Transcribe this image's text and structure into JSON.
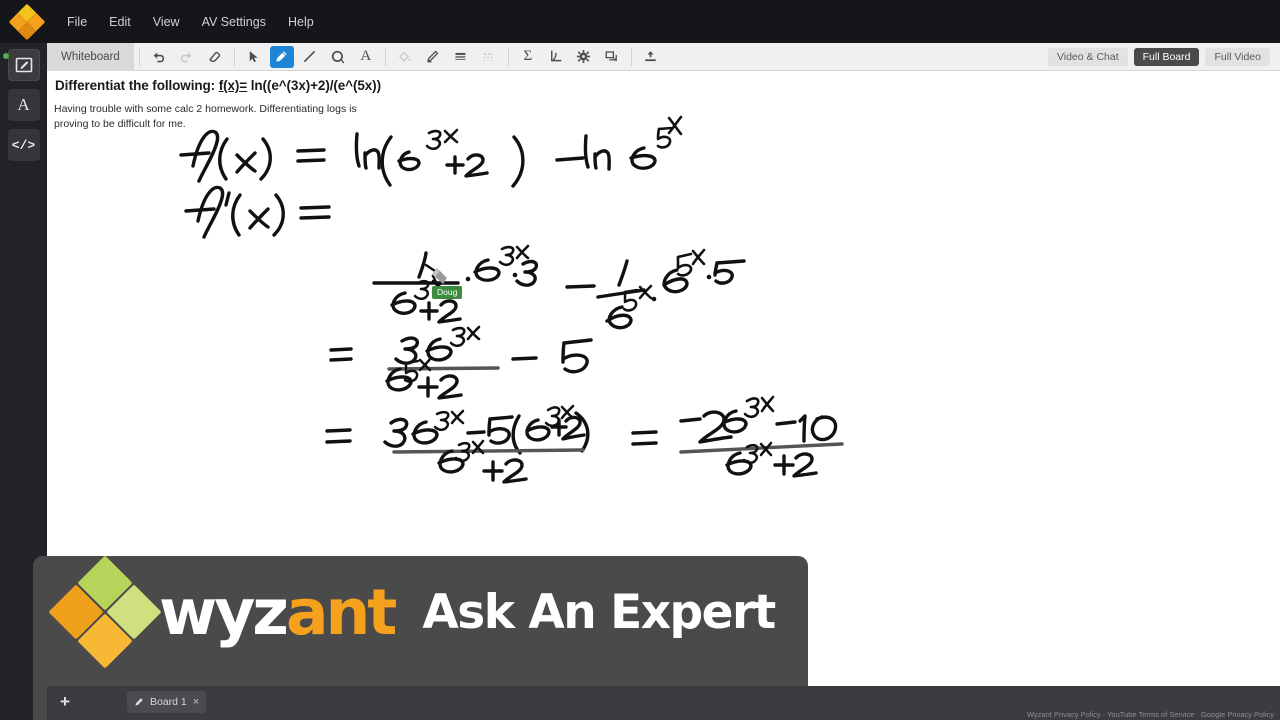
{
  "app": {
    "brand_name": "wyzant",
    "accent_orange": "#f5a11e",
    "accent_green": "#9fc93c",
    "accent_yellow": "#f2c41c",
    "active_tool_blue": "#1e85d6",
    "cursor_green": "#3d8b3d"
  },
  "menubar": {
    "logo_name": "wyzant-diamond-logo",
    "items": [
      {
        "label": "File",
        "name": "menu-file"
      },
      {
        "label": "Edit",
        "name": "menu-edit"
      },
      {
        "label": "View",
        "name": "menu-view"
      },
      {
        "label": "AV Settings",
        "name": "menu-av-settings"
      },
      {
        "label": "Help",
        "name": "menu-help"
      }
    ]
  },
  "left_rail": {
    "items": [
      {
        "name": "sidebar-item-whiteboard",
        "icon": "whiteboard-pen-icon",
        "active": true,
        "status_dot": true
      },
      {
        "name": "sidebar-item-text",
        "icon": "text-document-icon",
        "glyph": "A",
        "active": false
      },
      {
        "name": "sidebar-item-code",
        "icon": "code-icon",
        "glyph": "</>",
        "active": false
      }
    ]
  },
  "toolbar": {
    "whiteboard_tab_label": "Whiteboard",
    "tools": [
      {
        "name": "undo-button",
        "icon": "undo-arrow-icon",
        "state": "enabled"
      },
      {
        "name": "redo-button",
        "icon": "redo-arrow-icon",
        "state": "disabled"
      },
      {
        "name": "eraser-button",
        "icon": "eraser-icon",
        "state": "enabled"
      },
      {
        "name": "select-button",
        "icon": "cursor-arrow-icon",
        "state": "enabled"
      },
      {
        "name": "pen-button",
        "icon": "pen-icon",
        "state": "selected"
      },
      {
        "name": "line-button",
        "icon": "line-icon",
        "state": "enabled"
      },
      {
        "name": "shape-button",
        "icon": "ellipse-shape-icon",
        "state": "enabled"
      },
      {
        "name": "text-button",
        "icon": "text-a-icon",
        "state": "enabled"
      },
      {
        "name": "fill-button",
        "icon": "paint-bucket-icon",
        "state": "disabled"
      },
      {
        "name": "stroke-color-button",
        "icon": "marker-color-icon",
        "state": "enabled"
      },
      {
        "name": "stroke-width-button",
        "icon": "line-weight-icon",
        "state": "enabled"
      },
      {
        "name": "line-style-button",
        "icon": "dashed-line-icon",
        "state": "disabled"
      },
      {
        "name": "math-button",
        "icon": "sigma-math-icon",
        "state": "enabled"
      },
      {
        "name": "graph-button",
        "icon": "graph-axes-icon",
        "state": "enabled"
      },
      {
        "name": "settings-button",
        "icon": "gear-icon",
        "state": "enabled"
      },
      {
        "name": "duplicate-button",
        "icon": "copy-layers-icon",
        "state": "enabled"
      },
      {
        "name": "upload-button",
        "icon": "upload-icon",
        "state": "enabled"
      }
    ],
    "view_buttons": [
      {
        "label": "Video & Chat",
        "name": "video-and-chat-button",
        "active": false
      },
      {
        "label": "Full Board",
        "name": "full-board-button",
        "active": true
      },
      {
        "label": "Full Video",
        "name": "full-video-button",
        "active": false
      }
    ]
  },
  "question": {
    "title_prefix": "Differentiat the following: ",
    "title_underlined": "f(x)=",
    "title_rest": " ln((e^(3x)+2)/(e^(5x))",
    "body": "Having trouble with some calc 2 homework. Differentiating logs is proving to be difficult for me."
  },
  "whiteboard": {
    "handwriting_transcript": [
      "f(x)  =  ln(e^3x + 2)  - ln e^5x",
      "f'(x) =  1/(e^3x+2) · e^3x · 3   -   1/e^5x · e^5x · 5",
      "=  3e^3x/(e^3x+2)  -  5",
      "=  (3e^3x - 5(e^3x+2))/(e^3x+2)   =   (-2e^3x - 10)/(e^3x+2)"
    ],
    "remote_cursor": {
      "label": "Doug",
      "icon": "pen-cursor-icon"
    }
  },
  "video_overlay": {
    "logo_word_white": "wyz",
    "logo_word_orange": "ant",
    "tagline": "Ask An Expert",
    "logo_mark_name": "wyzant-diamond-logo"
  },
  "board_bar": {
    "add_label": "+",
    "tabs": [
      {
        "label": "Board 1",
        "name": "board-tab-1",
        "close_label": "×",
        "icon": "pen-icon"
      }
    ]
  },
  "footer": {
    "links": "Wyzant Privacy Policy  ·  YouTube Terms of Service  ·  Google Privacy Policy"
  }
}
